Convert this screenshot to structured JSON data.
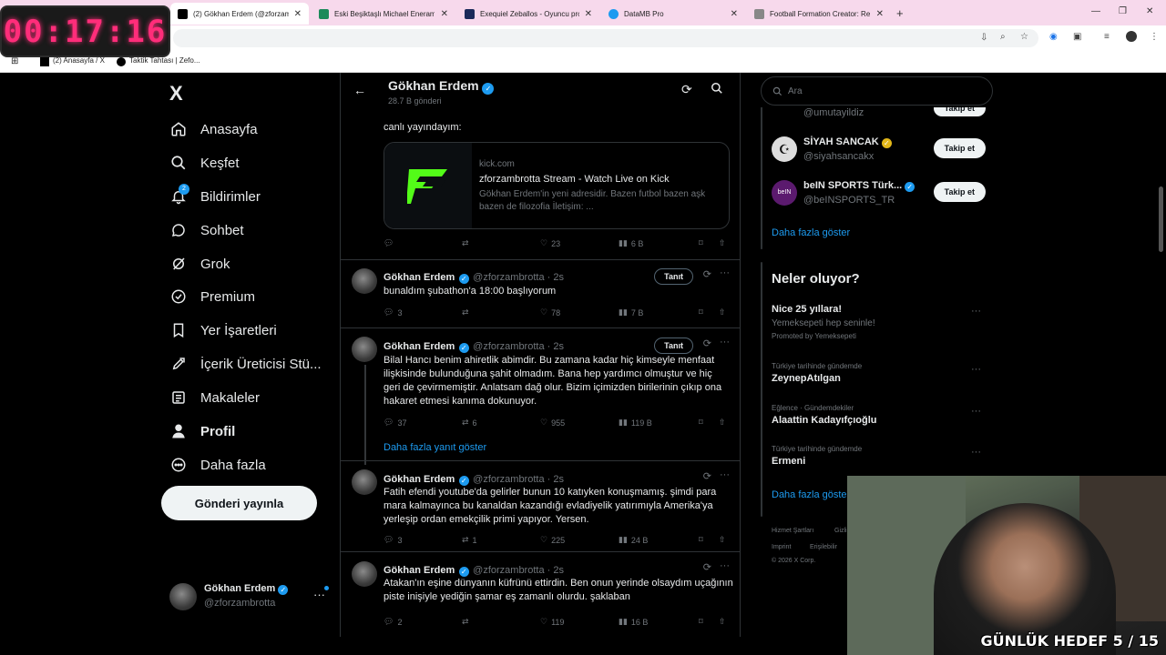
{
  "timer": "00:17:16",
  "browser": {
    "tabs": [
      {
        "title": "(2) Gökhan Erdem (@zforzambrotta)"
      },
      {
        "title": "Eski Beşiktaşlı Michael Eneramo"
      },
      {
        "title": "Exequiel Zeballos - Oyuncu profili"
      },
      {
        "title": "DataMB Pro"
      },
      {
        "title": "Football Formation Creator: Re"
      }
    ],
    "bookmarks": [
      "(2) Anasayfa / X",
      "Taktik Tahtası | Zefo..."
    ]
  },
  "nav": {
    "logo": "X",
    "items": [
      {
        "label": "Anasayfa",
        "icon": "home-icon"
      },
      {
        "label": "Keşfet",
        "icon": "search-icon"
      },
      {
        "label": "Bildirimler",
        "icon": "bell-icon",
        "badge": "2"
      },
      {
        "label": "Sohbet",
        "icon": "chat-icon"
      },
      {
        "label": "Grok",
        "icon": "grok-icon"
      },
      {
        "label": "Premium",
        "icon": "premium-icon"
      },
      {
        "label": "Yer İşaretleri",
        "icon": "bookmark-icon"
      },
      {
        "label": "İçerik Üreticisi Stü...",
        "icon": "rocket-icon"
      },
      {
        "label": "Makaleler",
        "icon": "article-icon"
      },
      {
        "label": "Profil",
        "icon": "profile-icon"
      },
      {
        "label": "Daha fazla",
        "icon": "more-icon"
      }
    ],
    "post_button": "Gönderi yayınla",
    "account": {
      "name": "Gökhan Erdem",
      "handle": "@zforzambrotta"
    }
  },
  "header": {
    "title": "Gökhan Erdem",
    "subtitle": "28.7 B gönderi"
  },
  "card_tweet": {
    "text": "canlı yayındayım:",
    "card": {
      "domain": "kick.com",
      "title": "zforzambrotta Stream - Watch Live on Kick",
      "desc": "Gökhan Erdem'in yeni adresidir. Bazen futbol bazen aşk bazen de filozofia İletişim: ..."
    },
    "stats": {
      "likes": "23",
      "views": "6 B"
    }
  },
  "tweets": [
    {
      "name": "Gökhan Erdem",
      "handle": "@zforzambrotta",
      "time": "2s",
      "follow": "Tanıt",
      "text": "bunaldım şubathon'a 18:00 başlıyorum",
      "replies": "3",
      "retweets": "",
      "likes": "78",
      "views": "7 B"
    },
    {
      "name": "Gökhan Erdem",
      "handle": "@zforzambrotta",
      "time": "2s",
      "follow": "Tanıt",
      "text": "Bilal Hancı benim ahiretlik abimdir. Bu zamana kadar hiç kimseyle menfaat ilişkisinde bulunduğuna şahit olmadım. Bana hep yardımcı olmuştur ve hiç geri de çevirmemiştir. Anlatsam dağ olur. Bizim içimizden birilerinin çıkıp ona hakaret etmesi kanıma dokunuyor.",
      "replies": "37",
      "retweets": "6",
      "likes": "955",
      "views": "119 B"
    },
    {
      "name": "Gökhan Erdem",
      "handle": "@zforzambrotta",
      "time": "2s",
      "follow": "",
      "text": "Fatih efendi youtube'da gelirler bunun 10 katıyken konuşmamış. şimdi para mara kalmayınca bu kanaldan kazandığı evladiyelik yatırımıyla Amerika'ya yerleşip ordan emekçilik primi yapıyor. Yersen.",
      "replies": "3",
      "retweets": "1",
      "likes": "225",
      "views": "24 B"
    },
    {
      "name": "Gökhan Erdem",
      "handle": "@zforzambrotta",
      "time": "2s",
      "follow": "",
      "text": "Atakan'ın eşine dünyanın küfrünü ettirdin. Ben onun yerinde olsaydım uçağının piste inişiyle yediğin şamar eş zamanlı olurdu. şaklaban",
      "replies": "2",
      "retweets": "",
      "likes": "119",
      "views": "16 B"
    }
  ],
  "more_replies": "Daha fazla yanıt göster",
  "right": {
    "search_placeholder": "Ara",
    "who_to_follow": [
      {
        "name": "",
        "handle": "@umutayildiz",
        "button": "Takip et"
      },
      {
        "name": "SİYAH SANCAK",
        "handle": "@siyahsancakx",
        "button": "Takip et"
      },
      {
        "name": "beIN SPORTS Türk...",
        "handle": "@beINSPORTS_TR",
        "button": "Takip et"
      }
    ],
    "show_more": "Daha fazla göster",
    "trends_title": "Neler oluyor?",
    "trends": [
      {
        "meta": "",
        "title": "Nice 25 yıllara!",
        "sub": "Yemeksepeti hep seninle!",
        "promo": "Promoted by Yemeksepeti"
      },
      {
        "meta": "Türkiye tarihinde gündemde",
        "title": "ZeynepAtılgan"
      },
      {
        "meta": "Eğlence · Gündemdekiler",
        "title": "Alaattin Kadayıfçıoğlu"
      },
      {
        "meta": "Türkiye tarihinde gündemde",
        "title": "Ermeni"
      }
    ],
    "trends_more": "Daha fazla göster",
    "footer": [
      "Hizmet Şartları",
      "Gizli",
      "Imprint",
      "Erişilebilir",
      "© 2026 X Corp."
    ]
  },
  "webcam": {
    "overlay": "GÜNLÜK HEDEF 5 / 15"
  }
}
